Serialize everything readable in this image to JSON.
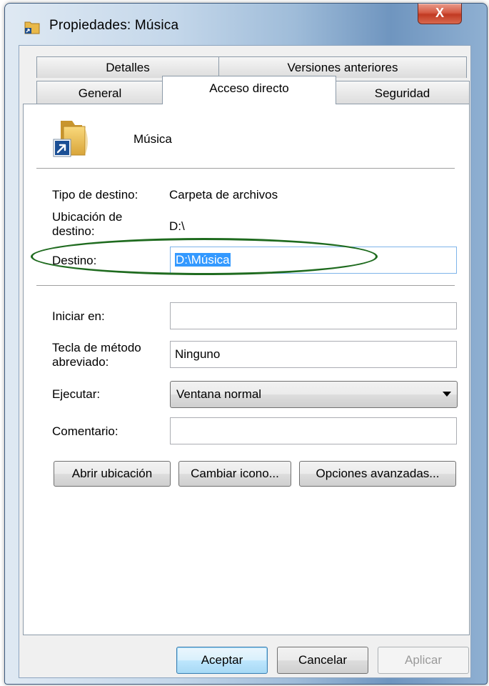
{
  "window": {
    "title": "Propiedades: Música",
    "close_label": "X",
    "icon": "folder-shortcut-icon"
  },
  "tabs": {
    "row1": [
      {
        "label": "Detalles"
      },
      {
        "label": "Versiones anteriores"
      }
    ],
    "row2": [
      {
        "label": "General"
      },
      {
        "label": "Acceso directo",
        "active": true
      },
      {
        "label": "Seguridad"
      }
    ]
  },
  "shortcut": {
    "name": "Música",
    "icon": "folder-shortcut-icon",
    "target_type_label": "Tipo de destino:",
    "target_type_value": "Carpeta de archivos",
    "target_location_label_1": "Ubicación de",
    "target_location_label_2": "destino:",
    "target_location_value": "D:\\",
    "target_label": "Destino:",
    "target_value": "D:\\Música",
    "start_in_label": "Iniciar en:",
    "start_in_value": "",
    "hotkey_label_1": "Tecla de método",
    "hotkey_label_2": "abreviado:",
    "hotkey_value": "Ninguno",
    "run_label": "Ejecutar:",
    "run_value": "Ventana normal",
    "comment_label": "Comentario:",
    "comment_value": ""
  },
  "actions": {
    "open_location": "Abrir ubicación",
    "change_icon": "Cambiar icono...",
    "advanced": "Opciones avanzadas..."
  },
  "footer": {
    "ok": "Aceptar",
    "cancel": "Cancelar",
    "apply": "Aplicar"
  },
  "colors": {
    "highlight": "#3399ff",
    "annotation": "#1f6b1f",
    "close_button": "#c13a22"
  }
}
